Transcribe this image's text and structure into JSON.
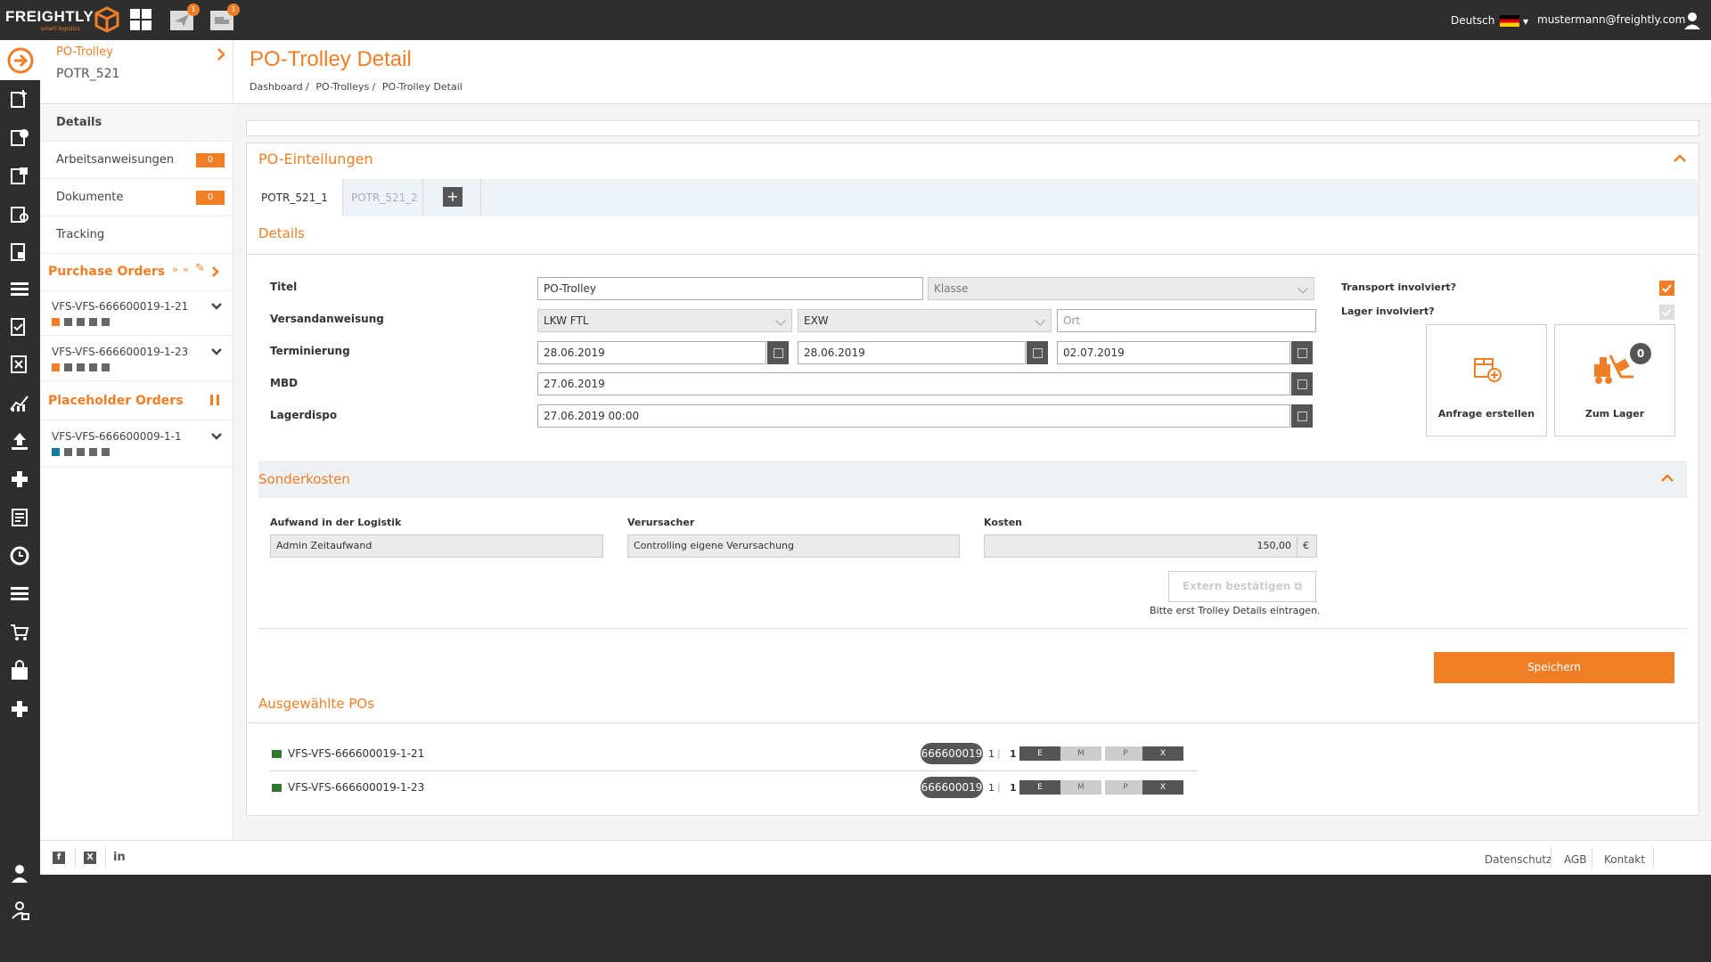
{
  "app": {
    "logo_word": "FREIGHTLY",
    "logo_tag": "smart logistics",
    "notif_counts": [
      "1",
      "1"
    ],
    "language": "Deutsch",
    "user_email": "mustermann@freightly.com"
  },
  "sidebar": {
    "context_title": "PO-Trolley",
    "context_id": "POTR_521",
    "items": [
      {
        "label": "Details"
      },
      {
        "label": "Arbeitsanweisungen",
        "count": "0"
      },
      {
        "label": "Dokumente",
        "count": "0"
      },
      {
        "label": "Tracking"
      }
    ],
    "purchase_orders_title": "Purchase Orders",
    "purchase_orders": [
      {
        "label": "VFS-VFS-666600019-1-21"
      },
      {
        "label": "VFS-VFS-666600019-1-23"
      }
    ],
    "placeholder_orders_title": "Placeholder Orders",
    "placeholder_orders": [
      {
        "label": "VFS-VFS-666600009-1-1"
      }
    ]
  },
  "header": {
    "title": "PO-Trolley Detail",
    "breadcrumb": [
      "Dashboard",
      "PO-Trolleys",
      "PO-Trolley Detail"
    ]
  },
  "main": {
    "section_title": "PO-Einteilungen",
    "tabs": [
      {
        "label": "POTR_521_1"
      },
      {
        "label": "POTR_521_2"
      }
    ],
    "details_title": "Details",
    "form": {
      "titel_label": "Titel",
      "titel_value": "PO-Trolley",
      "klasse_placeholder": "Klasse",
      "versand_label": "Versandanweisung",
      "versand_value": "LKW FTL",
      "incoterm_value": "EXW",
      "ort_placeholder": "Ort",
      "termin_label": "Terminierung",
      "termin_1": "28.06.2019",
      "termin_2": "28.06.2019",
      "termin_3": "02.07.2019",
      "mbd_label": "MBD",
      "mbd_value": "27.06.2019",
      "lagerdispo_label": "Lagerdispo",
      "lagerdispo_value": "27.06.2019 00:00"
    },
    "transport_label": "Transport involviert?",
    "lager_label": "Lager involviert?",
    "tile_anfrage": "Anfrage erstellen",
    "tile_lager": "Zum Lager",
    "tile_lager_count": "0",
    "sonderkosten": {
      "title": "Sonderkosten",
      "aufwand_label": "Aufwand in der Logistik",
      "aufwand_value": "Admin Zeitaufwand",
      "verursacher_label": "Verursacher",
      "verursacher_value": "Controlling eigene Verursachung",
      "kosten_label": "Kosten",
      "kosten_value": "150,00",
      "currency": "€",
      "extern_button": "Extern bestätigen",
      "hint": "Bitte erst Trolley Details eintragen."
    },
    "save_button": "Speichern",
    "selected_title": "Ausgewählte POs",
    "selected_pos": [
      {
        "label": "VFS-VFS-666600019-1-21",
        "pill": "666600019",
        "n1": "1",
        "n2": "1",
        "states": [
          "E",
          "M",
          "P",
          "X"
        ]
      },
      {
        "label": "VFS-VFS-666600019-1-23",
        "pill": "666600019",
        "n1": "1",
        "n2": "1",
        "states": [
          "E",
          "M",
          "P",
          "X"
        ]
      }
    ]
  },
  "footer": {
    "links": [
      "Datenschutz",
      "AGB",
      "Kontakt"
    ],
    "social": [
      "f",
      "X",
      "in"
    ]
  },
  "colors": {
    "accent": "#f07e26",
    "dark": "#2e2e2e"
  }
}
